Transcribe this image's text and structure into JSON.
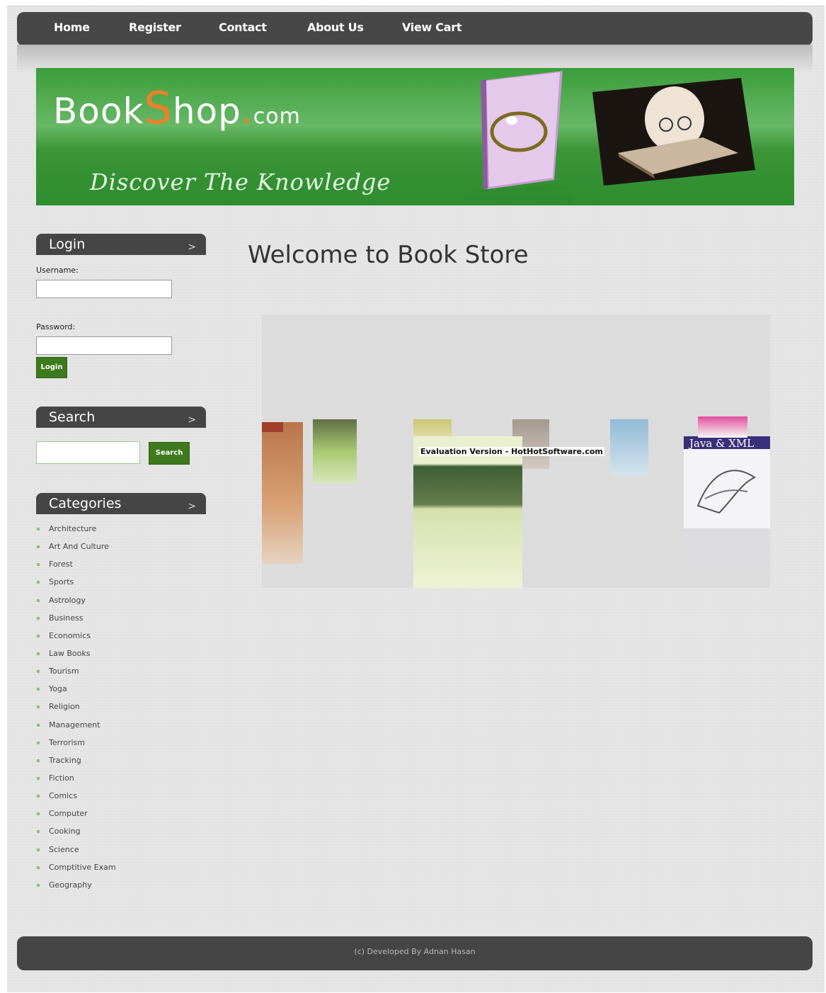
{
  "nav": {
    "items": [
      "Home",
      "Register",
      "Contact",
      "About Us",
      "View Cart"
    ]
  },
  "banner": {
    "logo_book": "Book",
    "logo_s": "S",
    "logo_hop": "hop",
    "logo_dot": ".",
    "logo_com": "com",
    "tagline": "Discover The Knowledge"
  },
  "login": {
    "title": "Login",
    "username_label": "Username:",
    "password_label": "Password:",
    "button": "Login"
  },
  "search": {
    "title": "Search",
    "button": "Search"
  },
  "categories": {
    "title": "Categories",
    "items": [
      "Architecture",
      "Art And Culture",
      "Forest",
      "Sports",
      "Astrology",
      "Business",
      "Economics",
      "Law Books",
      "Tourism",
      "Yoga",
      "Religion",
      "Management",
      "Terrorism",
      "Tracking",
      "Fiction",
      "Comics",
      "Computer",
      "Cooking",
      "Science",
      "Comptitive Exam",
      "Geography"
    ]
  },
  "main": {
    "welcome": "Welcome to Book Store",
    "watermark": "Evaluation Version - HotHotSoftware.com",
    "book_java": "Java & XML"
  },
  "footer": {
    "text": "(c) Developed By Adnan Hasan"
  },
  "colors": {
    "nav_bg": "#474747",
    "banner_green": "#3a9d3a",
    "accent_orange": "#f08026",
    "button_green": "#3d7a1e"
  }
}
